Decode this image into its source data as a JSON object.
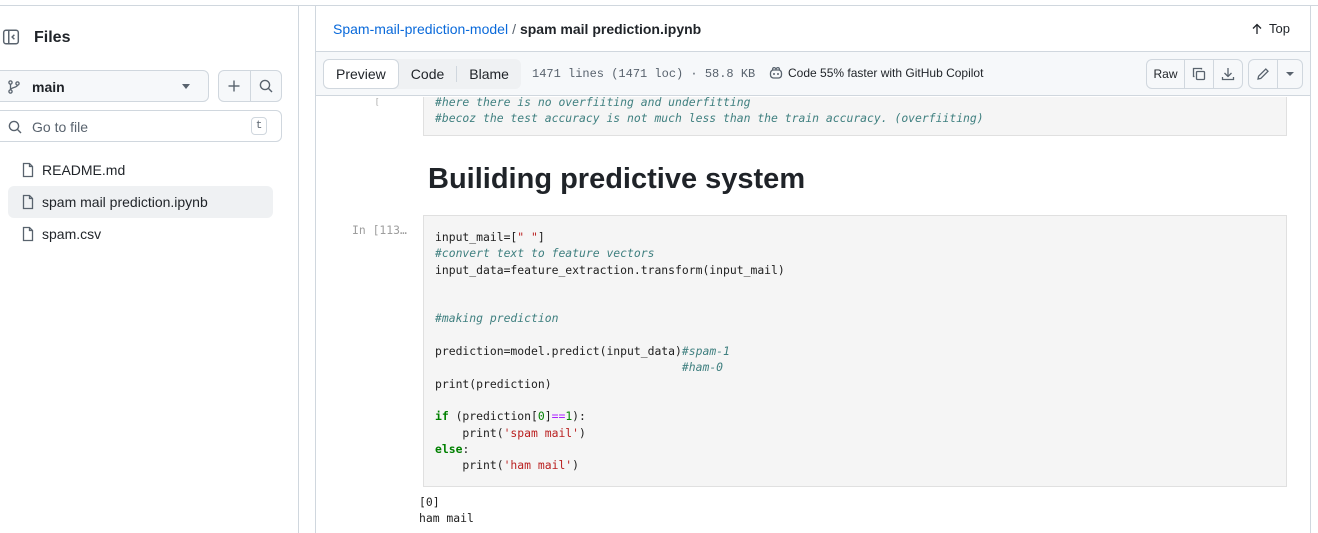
{
  "sidebar": {
    "title": "Files",
    "branch": "main",
    "goto_placeholder": "Go to file",
    "goto_shortcut": "t",
    "files": [
      {
        "name": "README.md",
        "active": false
      },
      {
        "name": "spam mail prediction.ipynb",
        "active": true
      },
      {
        "name": "spam.csv",
        "active": false
      }
    ]
  },
  "header": {
    "repo": "Spam-mail-prediction-model",
    "separator": "/",
    "file": "spam mail prediction.ipynb",
    "top_label": "Top"
  },
  "toolbar": {
    "tabs": [
      "Preview",
      "Code",
      "Blame"
    ],
    "active_tab": "Preview",
    "meta": "1471 lines (1471 loc) · 58.8 KB",
    "copilot": "Code 55% faster with GitHub Copilot",
    "raw_label": "Raw"
  },
  "notebook": {
    "prev_cell_comment1": "#here there is no overfiiting and underfitting",
    "prev_cell_comment2": "#becoz the test accuracy is not much less than the train accuracy. (overfiiting)",
    "heading": "Builiding predictive system",
    "prompt": "In [113…",
    "output_line1": "[0]",
    "output_line2": "ham mail"
  },
  "colors": {
    "link": "#0969da",
    "border": "#d0d7de",
    "code_bg": "#f5f5f5",
    "comment": "#408080",
    "keyword": "#008000",
    "string": "#ba2121"
  }
}
